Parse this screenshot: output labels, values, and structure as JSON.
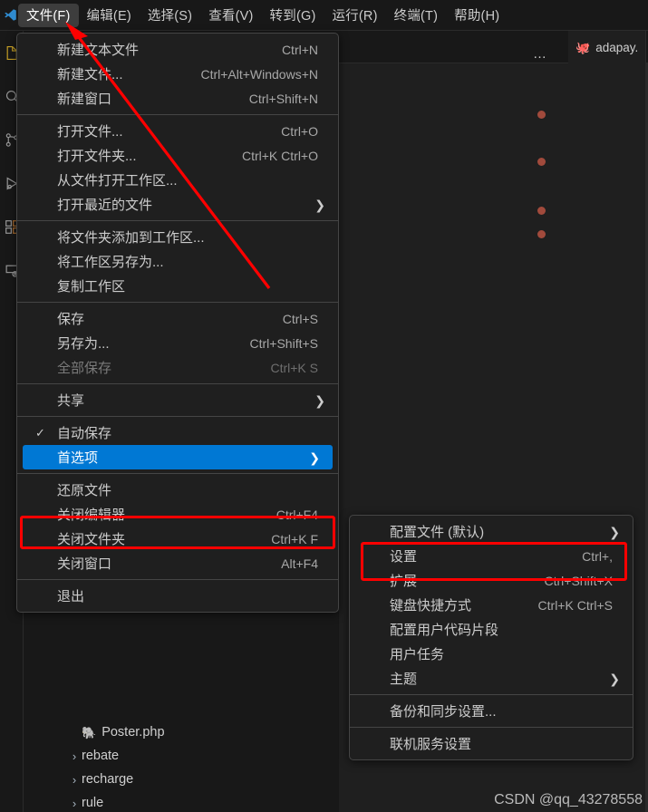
{
  "app": {
    "logo_icon": "vscode-logo",
    "watermark": "CSDN @qq_43278558"
  },
  "menubar": {
    "items": [
      {
        "label": "文件(F)",
        "active": true
      },
      {
        "label": "编辑(E)",
        "active": false
      },
      {
        "label": "选择(S)",
        "active": false
      },
      {
        "label": "查看(V)",
        "active": false
      },
      {
        "label": "转到(G)",
        "active": false
      },
      {
        "label": "运行(R)",
        "active": false
      },
      {
        "label": "终端(T)",
        "active": false
      },
      {
        "label": "帮助(H)",
        "active": false
      }
    ]
  },
  "activitybar": {
    "items": [
      {
        "icon": "explorer-icon"
      },
      {
        "icon": "search-icon"
      },
      {
        "icon": "source-control-icon"
      },
      {
        "icon": "run-and-debug-icon"
      },
      {
        "icon": "extensions-icon"
      },
      {
        "icon": "remote-explorer-icon"
      }
    ]
  },
  "editor": {
    "more_actions_label": "…",
    "tab": {
      "label": "adapay.",
      "icon": "php-icon"
    },
    "minimap_markers": [
      122,
      174,
      228,
      254
    ]
  },
  "explorer": {
    "rows": [
      {
        "chevron": "",
        "icon": "php-icon",
        "label": "Poster.php",
        "indent": "deep"
      },
      {
        "chevron": "›",
        "icon": "",
        "label": "rebate",
        "indent": "mid"
      },
      {
        "chevron": "›",
        "icon": "",
        "label": "recharge",
        "indent": "mid"
      },
      {
        "chevron": "›",
        "icon": "",
        "label": "rule",
        "indent": "mid"
      }
    ]
  },
  "file_menu": {
    "groups": [
      {
        "items": [
          {
            "label": "新建文本文件",
            "key": "Ctrl+N",
            "submenu": false,
            "checked": false,
            "disabled": false,
            "selected": false
          },
          {
            "label": "新建文件...",
            "key": "Ctrl+Alt+Windows+N",
            "submenu": false,
            "checked": false,
            "disabled": false,
            "selected": false
          },
          {
            "label": "新建窗口",
            "key": "Ctrl+Shift+N",
            "submenu": false,
            "checked": false,
            "disabled": false,
            "selected": false
          }
        ]
      },
      {
        "items": [
          {
            "label": "打开文件...",
            "key": "Ctrl+O",
            "submenu": false,
            "checked": false,
            "disabled": false,
            "selected": false
          },
          {
            "label": "打开文件夹...",
            "key": "Ctrl+K Ctrl+O",
            "submenu": false,
            "checked": false,
            "disabled": false,
            "selected": false
          },
          {
            "label": "从文件打开工作区...",
            "key": "",
            "submenu": false,
            "checked": false,
            "disabled": false,
            "selected": false
          },
          {
            "label": "打开最近的文件",
            "key": "",
            "submenu": true,
            "checked": false,
            "disabled": false,
            "selected": false
          }
        ]
      },
      {
        "items": [
          {
            "label": "将文件夹添加到工作区...",
            "key": "",
            "submenu": false,
            "checked": false,
            "disabled": false,
            "selected": false
          },
          {
            "label": "将工作区另存为...",
            "key": "",
            "submenu": false,
            "checked": false,
            "disabled": false,
            "selected": false
          },
          {
            "label": "复制工作区",
            "key": "",
            "submenu": false,
            "checked": false,
            "disabled": false,
            "selected": false
          }
        ]
      },
      {
        "items": [
          {
            "label": "保存",
            "key": "Ctrl+S",
            "submenu": false,
            "checked": false,
            "disabled": false,
            "selected": false
          },
          {
            "label": "另存为...",
            "key": "Ctrl+Shift+S",
            "submenu": false,
            "checked": false,
            "disabled": false,
            "selected": false
          },
          {
            "label": "全部保存",
            "key": "Ctrl+K S",
            "submenu": false,
            "checked": false,
            "disabled": true,
            "selected": false
          }
        ]
      },
      {
        "items": [
          {
            "label": "共享",
            "key": "",
            "submenu": true,
            "checked": false,
            "disabled": false,
            "selected": false
          }
        ]
      },
      {
        "items": [
          {
            "label": "自动保存",
            "key": "",
            "submenu": false,
            "checked": true,
            "disabled": false,
            "selected": false
          },
          {
            "label": "首选项",
            "key": "",
            "submenu": true,
            "checked": false,
            "disabled": false,
            "selected": true
          }
        ]
      },
      {
        "items": [
          {
            "label": "还原文件",
            "key": "",
            "submenu": false,
            "checked": false,
            "disabled": false,
            "selected": false
          },
          {
            "label": "关闭编辑器",
            "key": "Ctrl+F4",
            "submenu": false,
            "checked": false,
            "disabled": false,
            "selected": false
          },
          {
            "label": "关闭文件夹",
            "key": "Ctrl+K F",
            "submenu": false,
            "checked": false,
            "disabled": false,
            "selected": false
          },
          {
            "label": "关闭窗口",
            "key": "Alt+F4",
            "submenu": false,
            "checked": false,
            "disabled": false,
            "selected": false
          }
        ]
      },
      {
        "items": [
          {
            "label": "退出",
            "key": "",
            "submenu": false,
            "checked": false,
            "disabled": false,
            "selected": false
          }
        ]
      }
    ]
  },
  "prefs_menu": {
    "groups": [
      {
        "items": [
          {
            "label": "配置文件 (默认)",
            "key": "",
            "submenu": true,
            "checked": false,
            "disabled": false,
            "selected": false
          },
          {
            "label": "设置",
            "key": "Ctrl+,",
            "submenu": false,
            "checked": false,
            "disabled": false,
            "selected": false
          },
          {
            "label": "扩展",
            "key": "Ctrl+Shift+X",
            "submenu": false,
            "checked": false,
            "disabled": false,
            "selected": false
          },
          {
            "label": "键盘快捷方式",
            "key": "Ctrl+K Ctrl+S",
            "submenu": false,
            "checked": false,
            "disabled": false,
            "selected": false
          },
          {
            "label": "配置用户代码片段",
            "key": "",
            "submenu": false,
            "checked": false,
            "disabled": false,
            "selected": false
          },
          {
            "label": "用户任务",
            "key": "",
            "submenu": false,
            "checked": false,
            "disabled": false,
            "selected": false
          },
          {
            "label": "主题",
            "key": "",
            "submenu": true,
            "checked": false,
            "disabled": false,
            "selected": false
          }
        ]
      },
      {
        "items": [
          {
            "label": "备份和同步设置...",
            "key": "",
            "submenu": false,
            "checked": false,
            "disabled": false,
            "selected": false
          }
        ]
      },
      {
        "items": [
          {
            "label": "联机服务设置",
            "key": "",
            "submenu": false,
            "checked": false,
            "disabled": false,
            "selected": false
          }
        ]
      }
    ]
  },
  "annotations": {
    "color": "#ff0000",
    "boxes": [
      "首选项",
      "设置"
    ],
    "arrow": "points-to-file-menu"
  }
}
